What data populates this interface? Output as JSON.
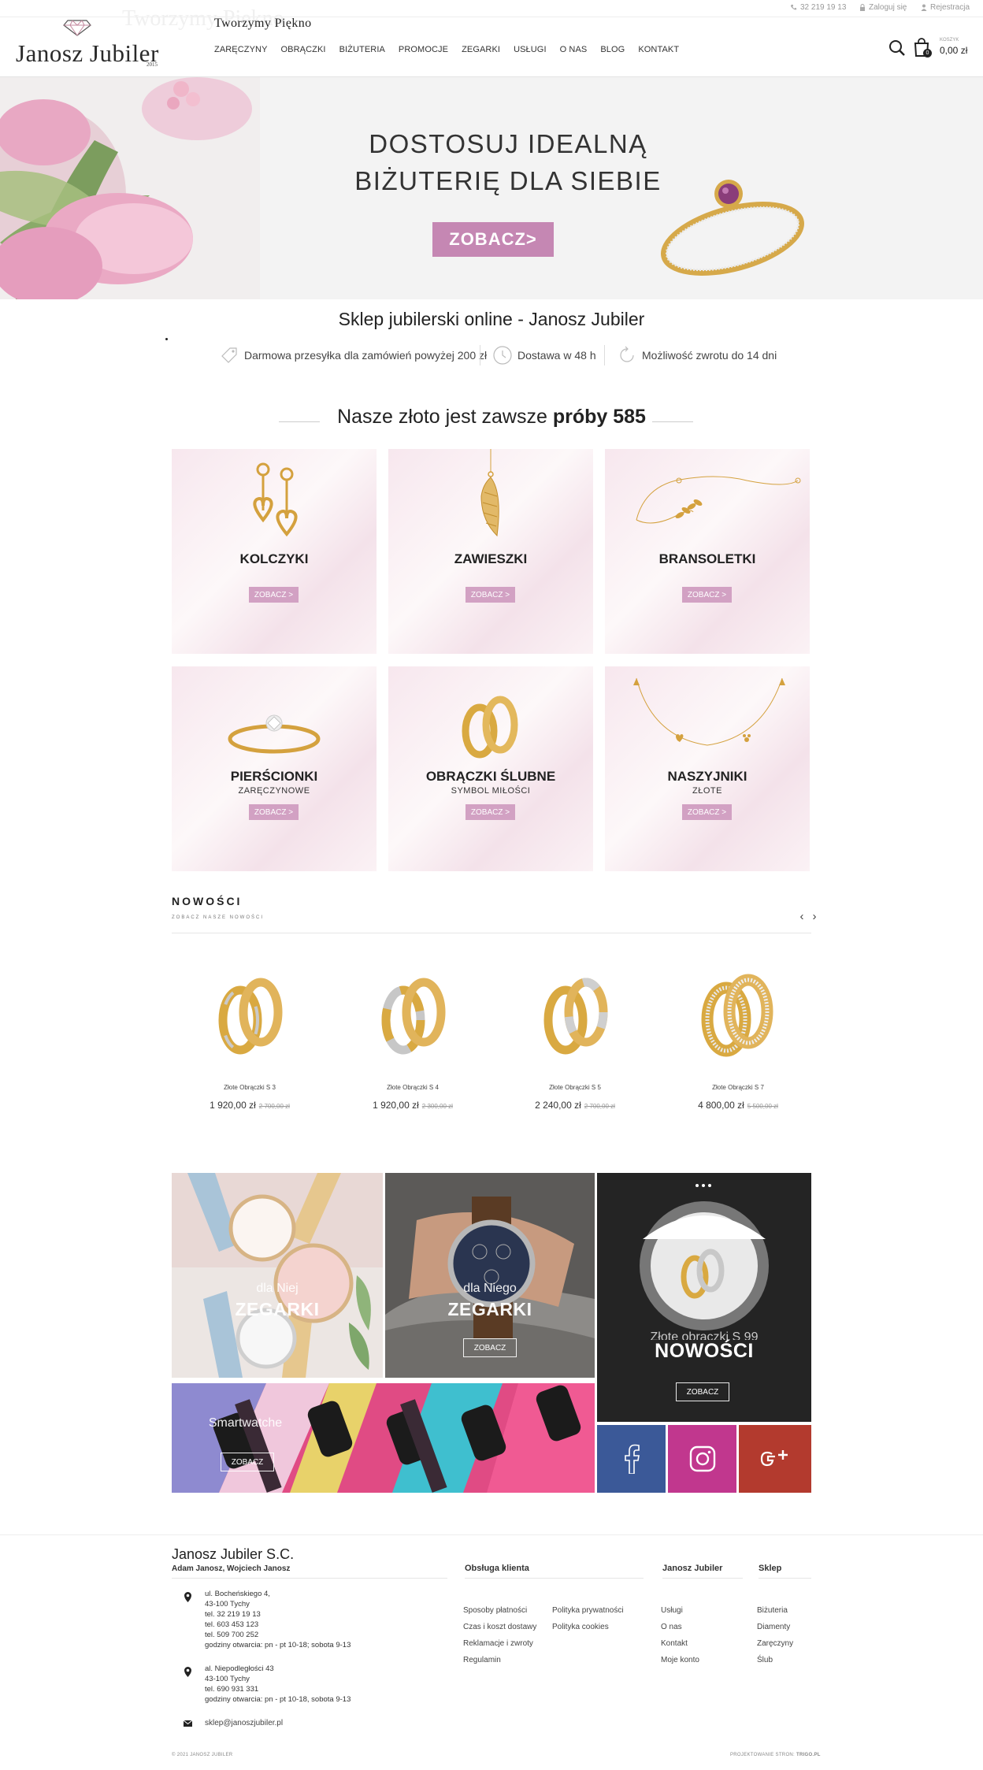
{
  "topbar": {
    "phone": "32 219 19 13",
    "login": "Zaloguj się",
    "register": "Rejestracja"
  },
  "header": {
    "logo": "Janosz Jubiler",
    "logo_year": "2015",
    "tagline_ghost": "Tworzymy Piękno",
    "tagline": "Tworzymy Piękno",
    "nav": [
      "ZARĘCZYNY",
      "OBRĄCZKI",
      "BIŻUTERIA",
      "PROMOCJE",
      "ZEGARKI",
      "USŁUGI",
      "O NAS",
      "BLOG",
      "KONTAKT"
    ],
    "cart": {
      "count": "0",
      "label": "KOSZYK",
      "total": "0,00 zł"
    }
  },
  "hero": {
    "line1": "DOSTOSUJ IDEALNĄ",
    "line2": "BIŻUTERIĘ DLA SIEBIE",
    "button": "ZOBACZ>"
  },
  "shop_title": "Sklep jubilerski online - Janosz Jubiler",
  "perks": [
    "Darmowa przesyłka dla zamówień powyżej 200 zł",
    "Dostawa w 48 h",
    "Możliwość zwrotu do 14 dni"
  ],
  "gold": {
    "text": "Nasze złoto jest zawsze",
    "bold": "próby 585"
  },
  "categories": [
    {
      "title": "KOLCZYKI",
      "sub": "",
      "button": "ZOBACZ >"
    },
    {
      "title": "ZAWIESZKI",
      "sub": "",
      "button": "ZOBACZ >"
    },
    {
      "title": "BRANSOLETKI",
      "sub": "",
      "button": "ZOBACZ >"
    },
    {
      "title": "PIERŚCIONKI",
      "sub": "ZARĘCZYNOWE",
      "button": "ZOBACZ >"
    },
    {
      "title": "OBRĄCZKI ŚLUBNE",
      "sub": "SYMBOL MIŁOŚCI",
      "button": "ZOBACZ >"
    },
    {
      "title": "NASZYJNIKI",
      "sub": "ZŁOTE",
      "button": "ZOBACZ >"
    }
  ],
  "new_section": {
    "title": "NOWOŚCI",
    "subtitle": "ZOBACZ NASZE NOWOŚCI"
  },
  "products": [
    {
      "name": "Złote Obrączki S 3",
      "price": "1 920,00 zł",
      "old_price": "2 700,00 zł"
    },
    {
      "name": "Złote Obrączki S 4",
      "price": "1 920,00 zł",
      "old_price": "2 300,00 zł"
    },
    {
      "name": "Złote Obrączki S 5",
      "price": "2 240,00 zł",
      "old_price": "2 700,00 zł"
    },
    {
      "name": "Złote Obrączki S 7",
      "price": "4 800,00 zł",
      "old_price": "5 500,00 zł"
    }
  ],
  "promo": {
    "her": {
      "sub": "dla Niej",
      "title": "ZEGARKI"
    },
    "him": {
      "sub": "dla Niego",
      "title": "ZEGARKI",
      "button": "ZOBACZ"
    },
    "smart": {
      "title": "Smartwatche",
      "button": "ZOBACZ"
    },
    "new": {
      "caption": "Złote obrączki S 99",
      "title": "NOWOŚCI",
      "button": "ZOBACZ"
    }
  },
  "footer": {
    "company": "Janosz Jubiler S.C.",
    "owners": "Adam Janosz, Wojciech Janosz",
    "addr1": [
      "ul. Bocheńskiego 4,",
      "43-100 Tychy",
      "tel. 32 219 19 13",
      "tel. 603 453 123",
      "tel. 509 700 252",
      "godziny otwarcia: pn - pt 10-18; sobota 9-13"
    ],
    "addr2": [
      "al. Niepodległości 43",
      "43-100 Tychy",
      "tel. 690 931 331",
      "godziny otwarcia: pn - pt 10-18, sobota 9-13"
    ],
    "email": "sklep@janoszjubiler.pl",
    "col1_title": "Obsługa klienta",
    "col1a": [
      "Sposoby płatności",
      "Czas i koszt dostawy",
      "Reklamacje i zwroty",
      "Regulamin"
    ],
    "col1b": [
      "Polityka prywatności",
      "Polityka cookies"
    ],
    "col2_title": "Janosz Jubiler",
    "col2": [
      "Usługi",
      "O nas",
      "Kontakt",
      "Moje konto"
    ],
    "col3_title": "Sklep",
    "col3": [
      "Biżuteria",
      "Diamenty",
      "Zaręczyny",
      "Ślub"
    ],
    "copyright": "© 2021 JANOSZ JUBILER",
    "credit_label": "PROJEKTOWANIE STRON:",
    "credit": "TRIGO.PL"
  },
  "colors": {
    "accent": "#c587b3",
    "dark": "#222222",
    "facebook": "#3b5998",
    "instagram": "#c1378e",
    "googleplus": "#b33a2e"
  }
}
